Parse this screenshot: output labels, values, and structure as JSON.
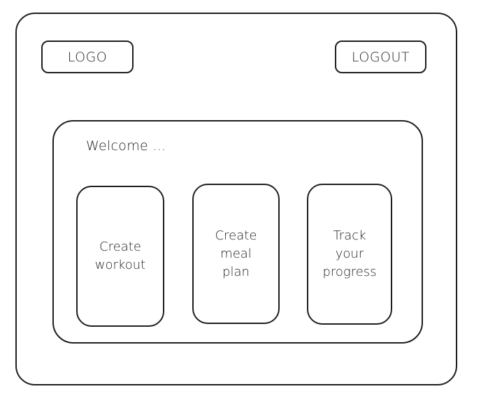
{
  "header": {
    "logo_label": "LOGO",
    "logout_label": "LOGOUT"
  },
  "main": {
    "welcome_text": "Welcome ...",
    "cards": [
      {
        "lines": [
          "Create",
          "workout"
        ]
      },
      {
        "lines": [
          "Create",
          "meal",
          "plan"
        ]
      },
      {
        "lines": [
          "Track",
          "your",
          "progress"
        ]
      }
    ]
  }
}
